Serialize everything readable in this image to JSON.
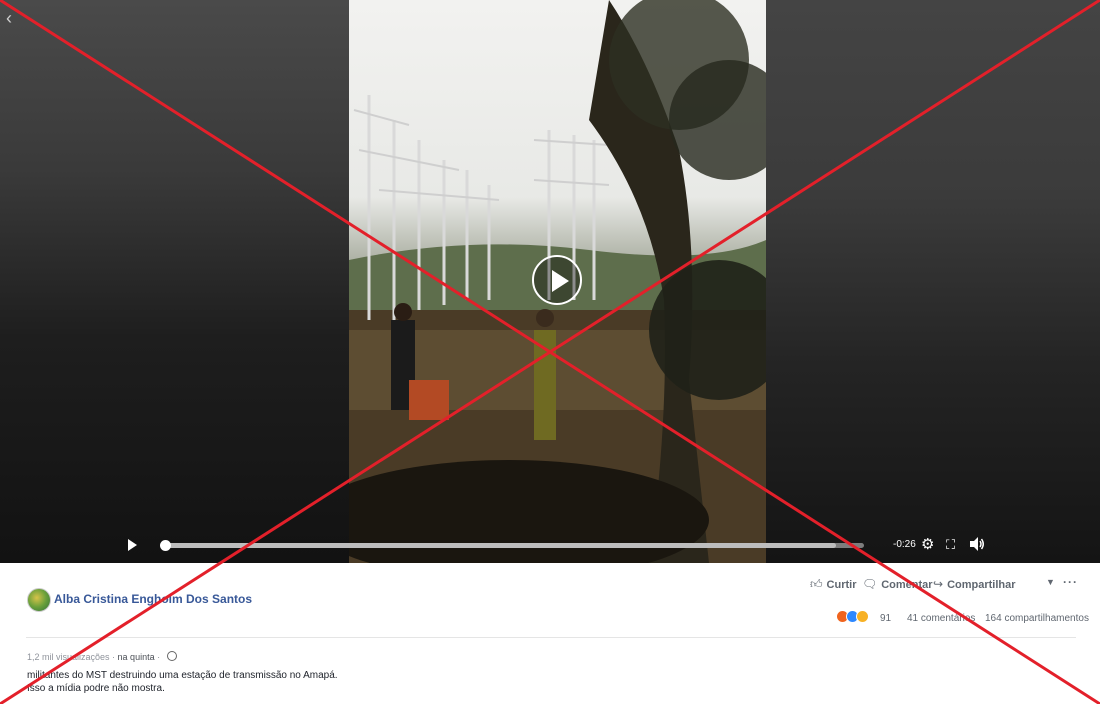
{
  "player": {
    "remaining_time": "-0:26",
    "progress": 0.0,
    "icons": [
      "back-icon",
      "play-icon",
      "settings-icon",
      "fullscreen-icon",
      "volume-icon"
    ]
  },
  "post": {
    "author": "Alba Cristina Engholm Dos Santos",
    "actions": {
      "like": "Curtir",
      "comment": "Comentar",
      "share": "Compartilhar"
    },
    "reactions": {
      "count": "91",
      "comments": "41 comentários",
      "shares": "164 compartilhamentos",
      "types": [
        "angry",
        "like",
        "sad"
      ]
    },
    "meta": {
      "views": "1,2 mil visualizações",
      "separator": " · ",
      "when": "na quinta",
      "separator2": " · "
    },
    "text_line1": "militantes do MST destruindo uma estação de transmissão no Amapá.",
    "text_line2": "Isso a mídia podre não mostra."
  },
  "colors": {
    "link": "#385898",
    "x_overlay": "#e3202a"
  }
}
